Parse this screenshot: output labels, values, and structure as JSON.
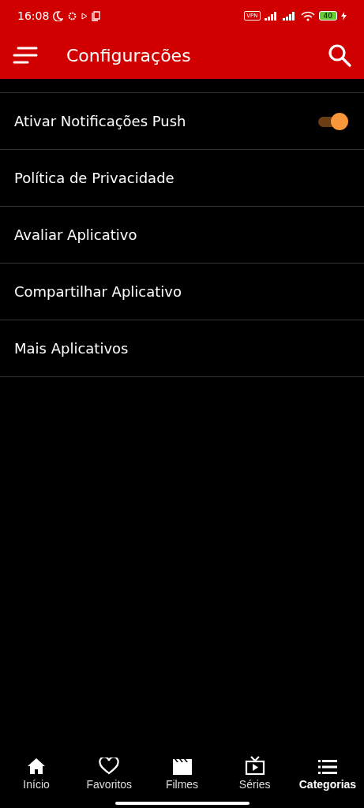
{
  "status_bar": {
    "time": "16:08",
    "vpn": "VPN",
    "battery": "40"
  },
  "app_bar": {
    "title": "Configurações"
  },
  "settings": [
    {
      "label": "Ativar Notificações Push",
      "kind": "toggle",
      "on": true
    },
    {
      "label": "Política de Privacidade",
      "kind": "link"
    },
    {
      "label": "Avaliar Aplicativo",
      "kind": "link"
    },
    {
      "label": "Compartilhar Aplicativo",
      "kind": "link"
    },
    {
      "label": "Mais Aplicativos",
      "kind": "link"
    }
  ],
  "bottom_nav": [
    {
      "label": "Início",
      "kind": "home",
      "selected": false
    },
    {
      "label": "Favoritos",
      "kind": "heart",
      "selected": false
    },
    {
      "label": "Filmes",
      "kind": "clapper",
      "selected": false
    },
    {
      "label": "Séries",
      "kind": "tv",
      "selected": false
    },
    {
      "label": "Categorias",
      "kind": "list",
      "selected": true
    }
  ]
}
